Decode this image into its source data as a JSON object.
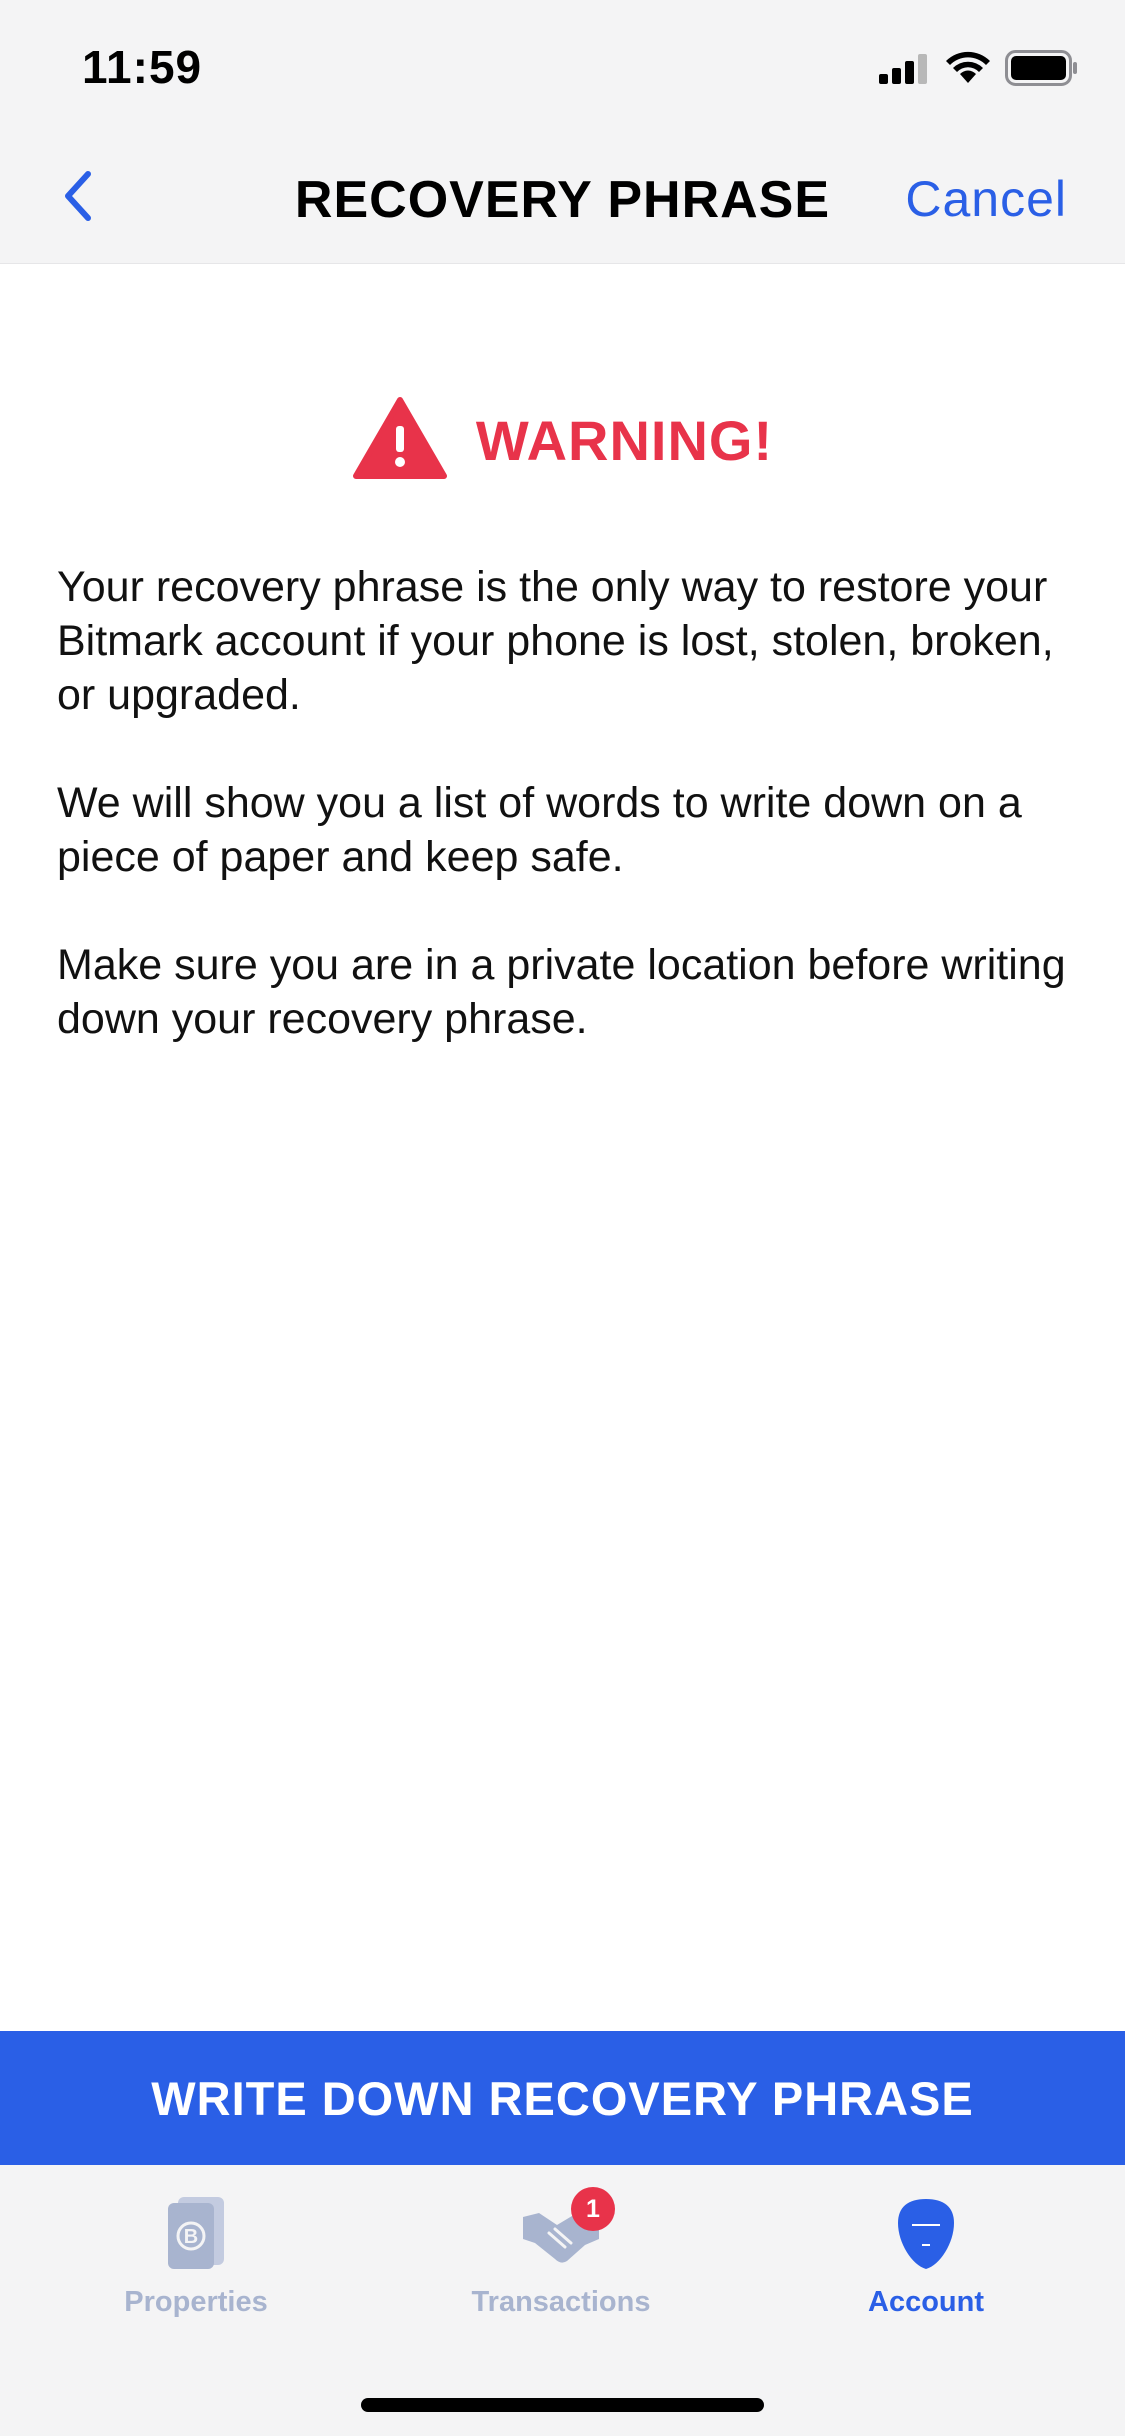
{
  "status_bar": {
    "time": "11:59",
    "icons": [
      "signal-icon",
      "wifi-icon",
      "battery-icon"
    ]
  },
  "nav": {
    "title": "RECOVERY PHRASE",
    "cancel_label": "Cancel",
    "back_icon": "chevron-left-icon"
  },
  "warning": {
    "label": "WARNING!",
    "icon": "warning-triangle-icon",
    "color": "#e8334a"
  },
  "body": {
    "paragraphs": [
      "Your recovery phrase is the only way to restore your Bitmark account if your phone is lost, stolen, broken, or upgraded.",
      "We will show you a list of words to write down on a piece of paper and keep safe.",
      "Make sure you are in a private location before writing down your recovery phrase."
    ]
  },
  "primary_action": {
    "label": "WRITE DOWN RECOVERY PHRASE",
    "color": "#2a5fe6"
  },
  "tab_bar": {
    "tabs": [
      {
        "label": "Properties",
        "icon": "properties-icon",
        "active": false
      },
      {
        "label": "Transactions",
        "icon": "handshake-icon",
        "active": false,
        "badge": "1"
      },
      {
        "label": "Account",
        "icon": "account-icon",
        "active": true
      }
    ]
  },
  "colors": {
    "accent": "#2a5fe6",
    "inactive_tab": "#a8b4cf",
    "nav_background": "#f4f4f5"
  }
}
